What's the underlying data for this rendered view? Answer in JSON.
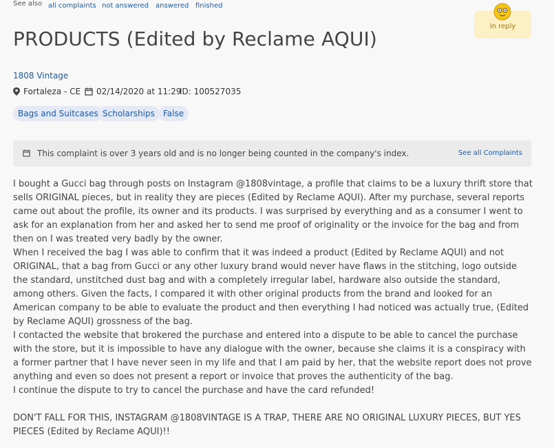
{
  "nav": {
    "see_also": "See also",
    "filters": [
      "all complaints",
      "not answered",
      "answered",
      "finished"
    ]
  },
  "status": {
    "label": "In reply",
    "icon": "smiley-face-icon",
    "color": "#fdf0c4"
  },
  "complaint": {
    "title": "PRODUCTS (Edited by Reclame AQUI)",
    "company": "1808 Vintage",
    "location": "Fortaleza - CE",
    "datetime": "02/14/2020 at 11:29",
    "id": "ID: 100527035",
    "tags": [
      "Bags and Suitcases",
      "Scholarships",
      "False"
    ]
  },
  "notice": {
    "text": "This complaint is over 3 years old and is no longer being counted in the company's index.",
    "link": "See all Complaints"
  },
  "body": {
    "p1": "I bought a Gucci bag through posts on Instagram @1808vintage, a profile that claims to be a luxury thrift store that sells ORIGINAL pieces, but in reality they are pieces (Edited by Reclame AQUI). After my purchase, several reports came out about the profile, its owner and its products. I was surprised by everything and as a consumer I went to ask for an explanation from her and asked her to send me proof of originality or the invoice for the bag and from then on I was treated very badly by the owner.",
    "p2": "When I received the bag I was able to confirm that it was indeed a product (Edited by Reclame AQUI) and not ORIGINAL, that a bag from Gucci or any other luxury brand would never have flaws in the stitching, logo outside the standard, unstitched dust bag and with a completely irregular label, hardware also outside the standard, among others. Given the facts, I compared it with other original products from the brand and looked for an American company to be able to evaluate the product and then everything I had noticed was actually true, (Edited by Reclame AQUI) grossness of the bag.",
    "p3": "I contacted the website that brokered the purchase and entered into a dispute to be able to cancel the purchase with the store, but it is impossible to have any dialogue with the owner, because she claims it is a conspiracy with a former partner that I have never seen in my life and that I am paid by her, that the website report does not prove anything and even so does not present a report or invoice that proves the authenticity of the bag.",
    "p4": "I continue the dispute to try to cancel the purchase and have the card refunded!",
    "p5": "DON'T FALL FOR THIS, INSTAGRAM @1808VINTAGE IS A TRAP, THERE ARE NO ORIGINAL LUXURY PIECES, BUT YES PIECES (Edited by Reclame AQUI)!!"
  }
}
